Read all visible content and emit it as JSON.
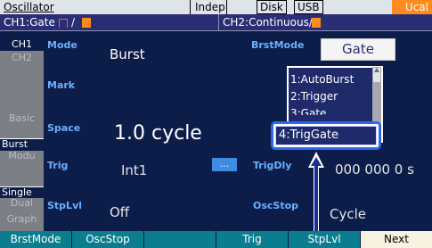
{
  "top_bar": {
    "title": "Oscillator",
    "mode": "Indep",
    "disk": "Disk",
    "usb": "USB",
    "cal": "Ucal"
  },
  "status_bar": {
    "ch1": "CH1:Gate",
    "ch1_sep": "/",
    "ch2": "CH2:Continuous/"
  },
  "tabs": {
    "ch1": "CH1",
    "ch2": "CH2",
    "basic": "Basic",
    "burst": "Burst",
    "modu": "Modu",
    "single": "Single",
    "dual": "Dual",
    "graph": "Graph"
  },
  "params": {
    "mode_label": "Mode",
    "mode_value": "Burst",
    "mark_label": "Mark",
    "space_label": "Space",
    "space_value": "1.0 cycle",
    "trig_label": "Trig",
    "trig_value": "Int1",
    "trig_button": "...",
    "stoplvl_label": "StpLvl",
    "stoplvl_value": "Off",
    "brstmode_label": "BrstMode",
    "brstmode_value": "Gate",
    "trigdly_label": "TrigDly",
    "trigdly_value": "000 000 0 s",
    "oscstop_label": "OscStop",
    "oscstop_value": "Cycle"
  },
  "menu": {
    "items": [
      "1:AutoBurst",
      "2:Trigger",
      "3:Gate",
      "4:TrigGate"
    ],
    "selected": "4:TrigGate"
  },
  "function_keys": [
    "BrstMode",
    "OscStop",
    "",
    "Trig",
    "StpLvl",
    "Next"
  ],
  "colors": {
    "background": "#0d1d4a",
    "label": "#6ab0ff",
    "accent_orange": "#ff8a1e",
    "fkey": "#0a7e8f",
    "highlight": "#2f65f2"
  }
}
